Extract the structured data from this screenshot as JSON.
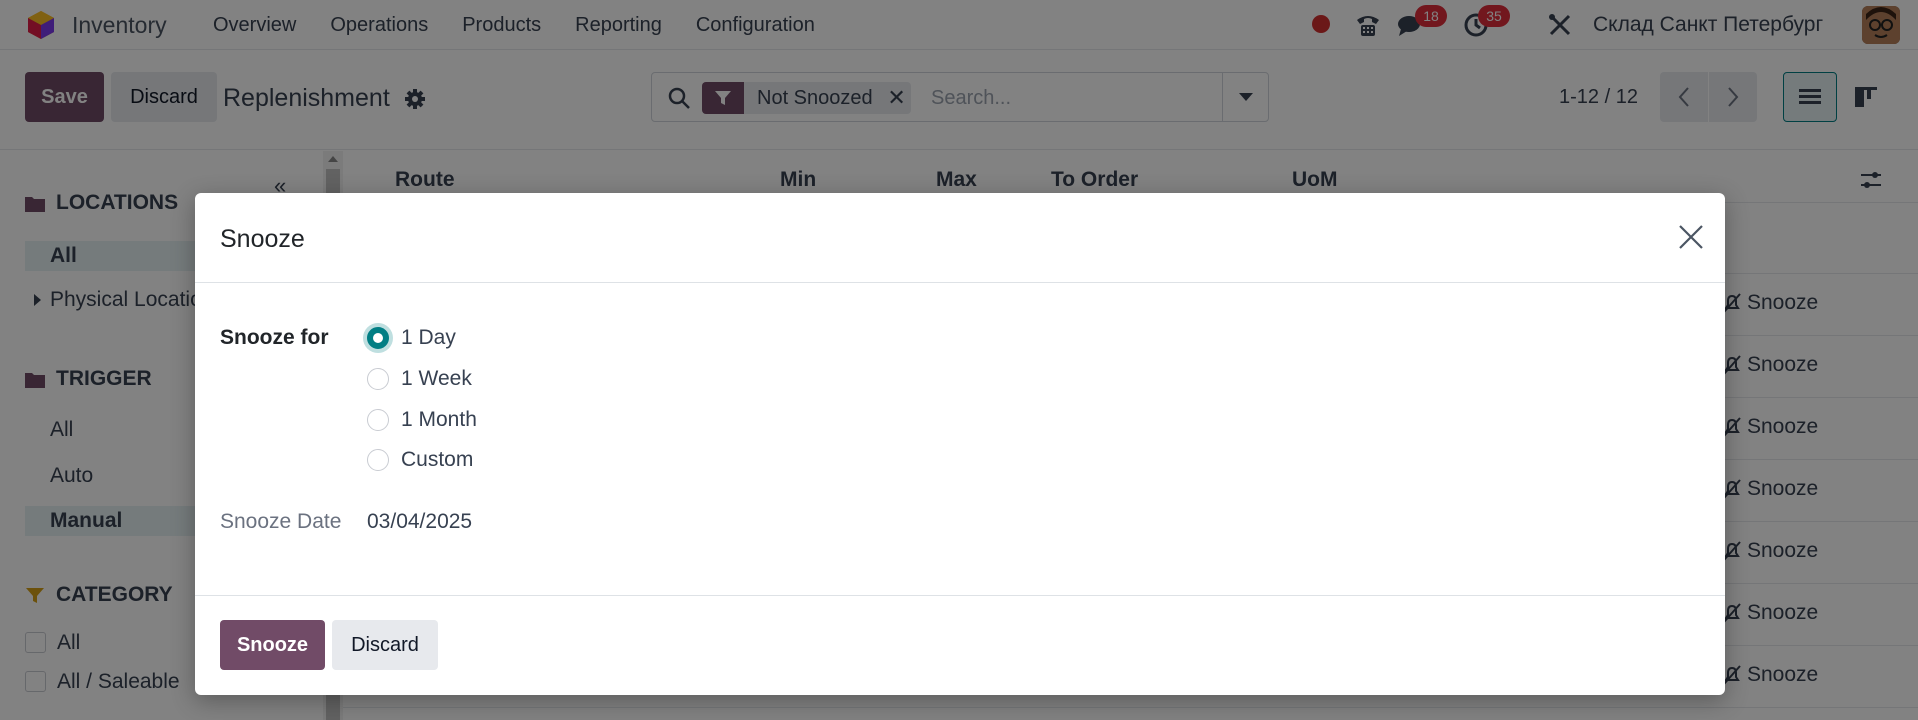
{
  "navbar": {
    "app_name": "Inventory",
    "menu": [
      "Overview",
      "Operations",
      "Products",
      "Reporting",
      "Configuration"
    ],
    "messages_count": "18",
    "activities_count": "35",
    "company": "Склад Санкт Петербург",
    "icons": [
      "brand-logo-icon",
      "phone-icon",
      "chat-icon",
      "clock-icon",
      "debug-tools-icon",
      "user-avatar"
    ]
  },
  "control": {
    "save_label": "Save",
    "discard_label": "Discard",
    "title": "Replenishment",
    "filter_facet": "Not Snoozed",
    "search_placeholder": "Search...",
    "pager": "1-12 / 12"
  },
  "sidepanel": {
    "locations_header": "LOCATIONS",
    "locations": [
      "All",
      "Physical Locations"
    ],
    "trigger_header": "TRIGGER",
    "triggers": [
      "All",
      "Auto",
      "Manual"
    ],
    "trigger_active": "Manual",
    "category_header": "CATEGORY",
    "categories": [
      "All",
      "All / Saleable"
    ]
  },
  "list": {
    "columns": [
      "Route",
      "Min",
      "Max",
      "To Order",
      "UoM"
    ],
    "row_action": "Snooze",
    "row_count_visible": 7
  },
  "dialog": {
    "title": "Snooze",
    "snooze_for_label": "Snooze for",
    "options": [
      "1 Day",
      "1 Week",
      "1 Month",
      "Custom"
    ],
    "selected_option": "1 Day",
    "snooze_date_label": "Snooze Date",
    "snooze_date_value": "03/04/2025",
    "confirm_label": "Snooze",
    "discard_label": "Discard"
  },
  "colors": {
    "primary": "#714b67",
    "accent": "#017e84",
    "badge": "#e02d3c",
    "recording": "#d32f2f"
  }
}
